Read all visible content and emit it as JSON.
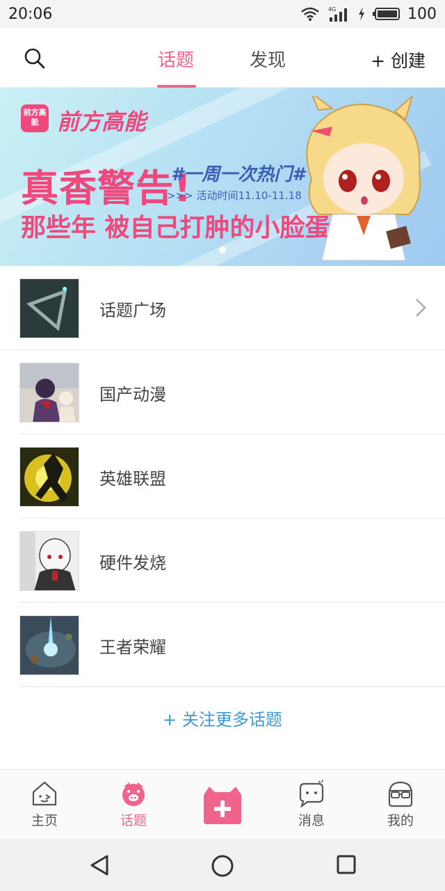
{
  "status_bar": {
    "time": "20:06",
    "network": "4G",
    "battery": "100",
    "icons": [
      "wifi-icon",
      "signal-icon",
      "charging-icon",
      "battery-icon"
    ]
  },
  "top_nav": {
    "search_icon": "search-icon",
    "tabs": [
      {
        "label": "话题",
        "active": true
      },
      {
        "label": "发现",
        "active": false
      }
    ],
    "create_label": "+ 创建"
  },
  "banner": {
    "brand_logo_text": "前方高能",
    "brand_name": "前方高能",
    "title": "真香警告!",
    "hashtag": "#一周一次热门#",
    "time_text": ">>> 活动时间11.10-11.18",
    "subtitle": "那些年 被自己打肿的小脸蛋",
    "page_indicator": {
      "count": 1,
      "active": 0
    }
  },
  "topics": [
    {
      "name": "话题广场",
      "has_arrow": true
    },
    {
      "name": "国产动漫",
      "has_arrow": false
    },
    {
      "name": "英雄联盟",
      "has_arrow": false
    },
    {
      "name": "硬件发烧",
      "has_arrow": false
    },
    {
      "name": "王者荣耀",
      "has_arrow": false
    }
  ],
  "follow_more_label": "+ 关注更多话题",
  "bottom_tabs": [
    {
      "label": "主页",
      "icon": "home-icon",
      "active": false
    },
    {
      "label": "话题",
      "icon": "topic-pig-icon",
      "active": true
    },
    {
      "label": "",
      "icon": "add-post-icon",
      "active": false
    },
    {
      "label": "消息",
      "icon": "message-icon",
      "active": false
    },
    {
      "label": "我的",
      "icon": "profile-glasses-icon",
      "active": false
    }
  ],
  "colors": {
    "accent": "#f0648c",
    "link": "#3d98d6",
    "banner_pink": "#f0487c",
    "banner_blue": "#3b5fb8"
  }
}
